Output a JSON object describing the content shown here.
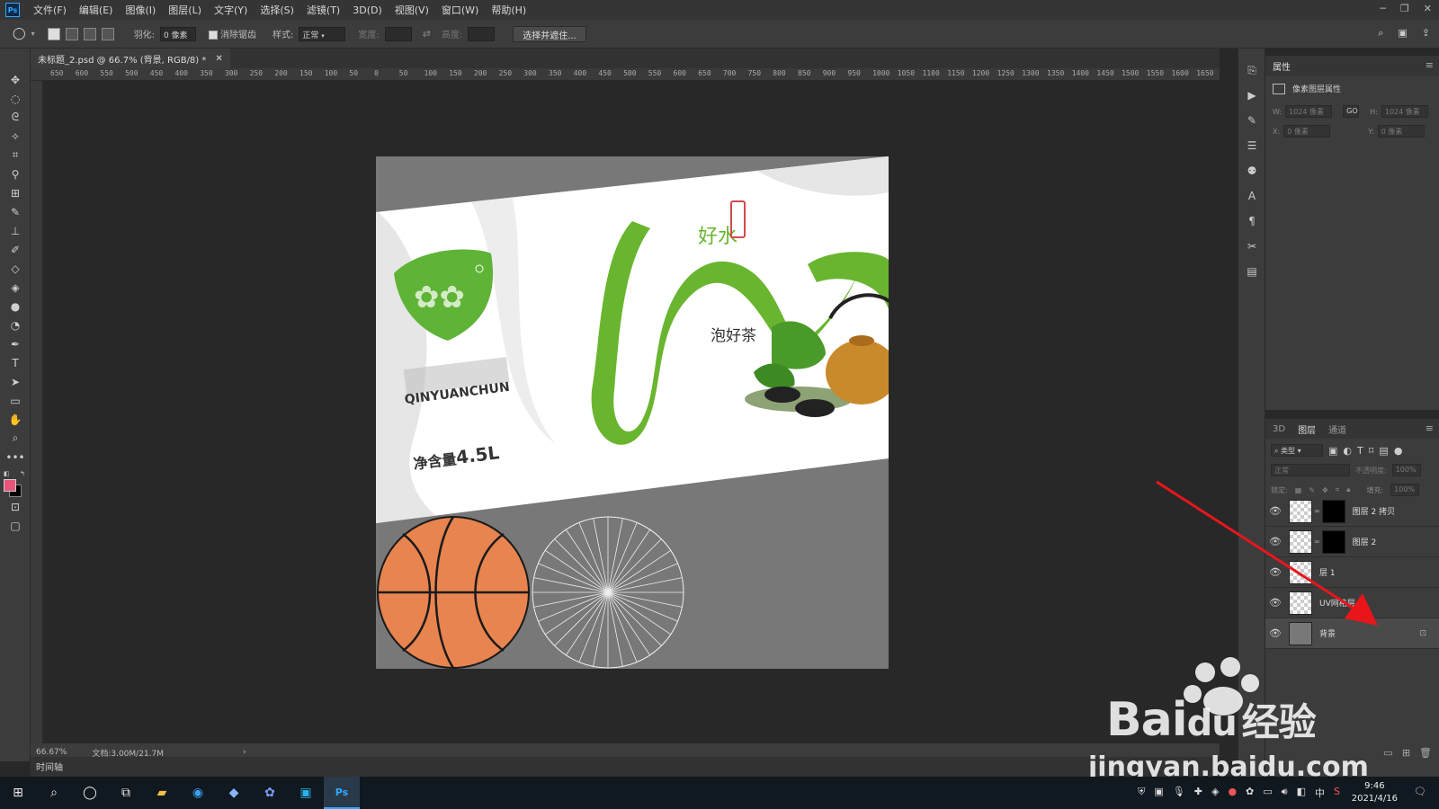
{
  "menubar": {
    "logo": "Ps",
    "items": [
      "文件(F)",
      "编辑(E)",
      "图像(I)",
      "图层(L)",
      "文字(Y)",
      "选择(S)",
      "滤镜(T)",
      "3D(D)",
      "视图(V)",
      "窗口(W)",
      "帮助(H)"
    ]
  },
  "options": {
    "feather_label": "羽化:",
    "feather_value": "0 像素",
    "antialias_label": "消除锯齿",
    "style_label": "样式:",
    "style_value": "正常",
    "width_label": "宽度:",
    "height_label": "高度:",
    "select_mask_button": "选择并遮住..."
  },
  "document": {
    "tab_title": "未标题_2.psd @ 66.7% (背景, RGB/8) *",
    "zoom": "66.67%",
    "doc_size": "文档:3.00M/21.7M"
  },
  "ruler": {
    "h_ticks": [
      "650",
      "600",
      "550",
      "500",
      "450",
      "400",
      "350",
      "300",
      "250",
      "200",
      "150",
      "100",
      "50",
      "0",
      "50",
      "100",
      "150",
      "200",
      "250",
      "300",
      "350",
      "400",
      "450",
      "500",
      "550",
      "600",
      "650",
      "700",
      "750",
      "800",
      "850",
      "900",
      "950",
      "1000",
      "1050",
      "1100",
      "1150",
      "1200",
      "1250",
      "1300",
      "1350",
      "1400",
      "1450",
      "1500",
      "1550",
      "1600",
      "1650"
    ]
  },
  "artwork": {
    "good_water": "好水",
    "brew_tea": "泡好茶",
    "brand_roman": "QINYUANCHUN",
    "net_label": "净含量",
    "net_value": "4.5L"
  },
  "timeline": {
    "label": "时间轴"
  },
  "properties": {
    "tab": "属性",
    "title": "像素图层属性",
    "w_label": "W:",
    "w_value": "1024 像素",
    "h_label": "H:",
    "h_value": "1024 像素",
    "link": "GO",
    "x_label": "X:",
    "x_value": "0 像素",
    "y_label": "Y:",
    "y_value": "0 像素"
  },
  "layers_panel": {
    "tabs": [
      "3D",
      "图层",
      "通道"
    ],
    "filter": "类型",
    "blend": "正常",
    "opacity_label": "不透明度:",
    "opacity_value": "100%",
    "lock_label": "锁定:",
    "fill_label": "填充:",
    "fill_value": "100%",
    "layers": [
      {
        "name": "图层 2 拷贝",
        "mask": true
      },
      {
        "name": "图层 2",
        "mask": true
      },
      {
        "name": "层 1",
        "mask": false
      },
      {
        "name": "UV网格层",
        "mask": false
      },
      {
        "name": "背景",
        "mask": false,
        "locked": true
      }
    ]
  },
  "taskbar": {
    "time": "9:46",
    "date": "2021/4/16",
    "ime": "中"
  },
  "watermark": {
    "brand": "Bai",
    "brand_tail": "du",
    "brand_cn": "经验",
    "url": "jingyan.baidu.com"
  },
  "colors": {
    "foreground": "#e8557a",
    "background": "#000000",
    "tea_green": "#6ab530",
    "basketball": "#e8844f",
    "arrow": "#e8161b"
  }
}
